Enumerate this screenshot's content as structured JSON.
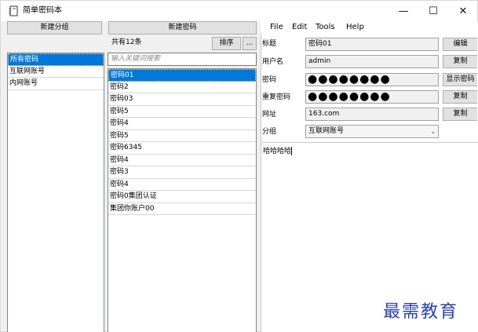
{
  "window": {
    "title": "简单密码本",
    "controls": {
      "minimize": "—",
      "maximize": "☐",
      "close": "✕"
    }
  },
  "groups_panel": {
    "new_group_label": "新建分组",
    "items": [
      {
        "label": "所有密码",
        "selected": true
      },
      {
        "label": "互联网账号",
        "selected": false
      },
      {
        "label": "内网账号",
        "selected": false
      }
    ]
  },
  "passwords_panel": {
    "new_password_label": "新建密码",
    "count_text": "共有12条",
    "sort_label": "排序",
    "more_label": "...",
    "search_placeholder": "输入关键词搜索",
    "items": [
      {
        "label": "密码01",
        "selected": true
      },
      {
        "label": "密码2",
        "selected": false
      },
      {
        "label": "密码03",
        "selected": false
      },
      {
        "label": "密码5",
        "selected": false
      },
      {
        "label": "密码4",
        "selected": false
      },
      {
        "label": "密码5",
        "selected": false
      },
      {
        "label": "密码6345",
        "selected": false
      },
      {
        "label": "密码4",
        "selected": false
      },
      {
        "label": "密码3",
        "selected": false
      },
      {
        "label": "密码4",
        "selected": false
      },
      {
        "label": "密码0集团认证",
        "selected": false
      },
      {
        "label": "集团你账户00",
        "selected": false
      }
    ]
  },
  "menubar": {
    "file": "File",
    "edit": "Edit",
    "tools": "Tools",
    "help": "Help"
  },
  "details": {
    "title_label": "标题",
    "title_value": "密码01",
    "edit_button": "编辑",
    "username_label": "用户名",
    "username_value": "admin",
    "copy_username_button": "复制",
    "password_label": "密码",
    "password_value": "●●●●●●●●",
    "show_password_button": "显示密码",
    "confirm_label": "重复密码",
    "confirm_value": "●●●●●●●●",
    "copy_password_button": "复制",
    "url_label": "网址",
    "url_value": "163.com",
    "copy_url_button": "复制",
    "group_label": "分组",
    "group_value": "互联网账号",
    "notes": "哈哈哈哈"
  },
  "watermark": "最需教育"
}
